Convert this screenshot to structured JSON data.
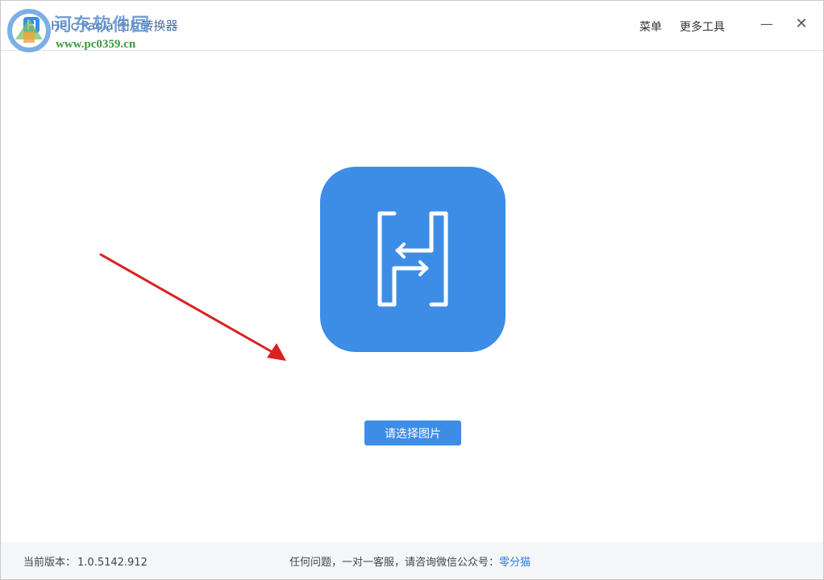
{
  "titlebar": {
    "app_title": "Heic Paola 图片转换器",
    "menu_label": "菜单",
    "tools_label": "更多工具",
    "minimize_glyph": "—",
    "close_glyph": "✕"
  },
  "watermark": {
    "site_name": "河东软件园",
    "site_url": "www.pc0359.cn"
  },
  "main": {
    "logo_icon": "heic-converter-logo-icon",
    "select_button": "请选择图片"
  },
  "footer": {
    "version_label": "当前版本：",
    "version_value": "1.0.5142.912",
    "support_text": "任何问题，一对一客服，请咨询微信公众号：",
    "support_link": "零分猫"
  },
  "colors": {
    "brand_blue": "#3d8de6",
    "annotation_red": "#d9211f",
    "footer_bg": "#f5f6f8",
    "link_blue": "#2f7bd8"
  }
}
